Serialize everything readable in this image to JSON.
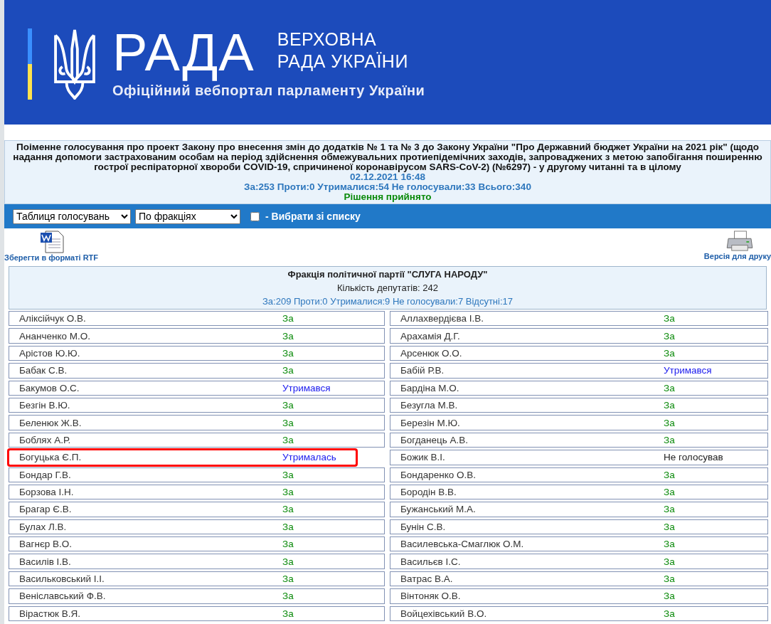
{
  "header": {
    "logo_word": "РАДА",
    "logo_line_1": "ВЕРХОВНА",
    "logo_line_2": "РАДА УКРАЇНИ",
    "tagline": "Офіційний вебпортал парламенту України"
  },
  "vote": {
    "title": "Поіменне голосування про проект Закону про внесення змін до додатків № 1 та № 3 до Закону України \"Про Державний бюджет України на 2021 рік\" (щодо надання допомоги застрахованим особам на період здійснення обмежувальних протиепідемічних заходів, запроваджених з метою запобігання поширенню гострої респіраторної хвороби COVID-19, спричиненої коронавірусом SARS-CoV-2) (№6297) - у другому читанні та в цілому",
    "datetime": "02.12.2021 16:48",
    "totals": "За:253 Проти:0 Утрималися:54 Не голосували:33 Всього:340",
    "result": "Рішення прийнято"
  },
  "toolbar": {
    "view_select": "Таблиця голосувань",
    "group_select": "По фракціях",
    "pick_from_list": {
      "label": "- Вибрати зі списку",
      "checked": false
    }
  },
  "actions": {
    "save_rtf": "Зберегти в форматі RTF",
    "print_version": "Версія для друку"
  },
  "faction": {
    "name": "Фракція політичної партії \"СЛУГА НАРОДУ\"",
    "deputies_count": "Кількість депутатів: 242",
    "totals": "За:209 Проти:0 Утрималися:9 Не голосували:7 Відсутні:17"
  },
  "deputies": [
    {
      "name": "Аліксійчук О.В.",
      "vote": "За",
      "kind": "for",
      "highlighted": false
    },
    {
      "name": "Аллахвердієва І.В.",
      "vote": "За",
      "kind": "for",
      "highlighted": false
    },
    {
      "name": "Ананченко М.О.",
      "vote": "За",
      "kind": "for",
      "highlighted": false
    },
    {
      "name": "Арахамія Д.Г.",
      "vote": "За",
      "kind": "for",
      "highlighted": false
    },
    {
      "name": "Арістов Ю.Ю.",
      "vote": "За",
      "kind": "for",
      "highlighted": false
    },
    {
      "name": "Арсенюк О.О.",
      "vote": "За",
      "kind": "for",
      "highlighted": false
    },
    {
      "name": "Бабак С.В.",
      "vote": "За",
      "kind": "for",
      "highlighted": false
    },
    {
      "name": "Бабій Р.В.",
      "vote": "Утримався",
      "kind": "abstain",
      "highlighted": false
    },
    {
      "name": "Бакумов О.С.",
      "vote": "Утримався",
      "kind": "abstain",
      "highlighted": false
    },
    {
      "name": "Бардіна М.О.",
      "vote": "За",
      "kind": "for",
      "highlighted": false
    },
    {
      "name": "Безгін В.Ю.",
      "vote": "За",
      "kind": "for",
      "highlighted": false
    },
    {
      "name": "Безугла М.В.",
      "vote": "За",
      "kind": "for",
      "highlighted": false
    },
    {
      "name": "Беленюк Ж.В.",
      "vote": "За",
      "kind": "for",
      "highlighted": false
    },
    {
      "name": "Березін М.Ю.",
      "vote": "За",
      "kind": "for",
      "highlighted": false
    },
    {
      "name": "Боблях А.Р.",
      "vote": "За",
      "kind": "for",
      "highlighted": false
    },
    {
      "name": "Богданець А.В.",
      "vote": "За",
      "kind": "for",
      "highlighted": false
    },
    {
      "name": "Богуцька Є.П.",
      "vote": "Утрималась",
      "kind": "abstain",
      "highlighted": true
    },
    {
      "name": "Божик В.І.",
      "vote": "Не голосував",
      "kind": "not_voted",
      "highlighted": false
    },
    {
      "name": "Бондар Г.В.",
      "vote": "За",
      "kind": "for",
      "highlighted": false
    },
    {
      "name": "Бондаренко О.В.",
      "vote": "За",
      "kind": "for",
      "highlighted": false
    },
    {
      "name": "Борзова І.Н.",
      "vote": "За",
      "kind": "for",
      "highlighted": false
    },
    {
      "name": "Бородін В.В.",
      "vote": "За",
      "kind": "for",
      "highlighted": false
    },
    {
      "name": "Брагар Є.В.",
      "vote": "За",
      "kind": "for",
      "highlighted": false
    },
    {
      "name": "Бужанський М.А.",
      "vote": "За",
      "kind": "for",
      "highlighted": false
    },
    {
      "name": "Булах Л.В.",
      "vote": "За",
      "kind": "for",
      "highlighted": false
    },
    {
      "name": "Бунін С.В.",
      "vote": "За",
      "kind": "for",
      "highlighted": false
    },
    {
      "name": "Вагнєр В.О.",
      "vote": "За",
      "kind": "for",
      "highlighted": false
    },
    {
      "name": "Василевська-Смаглюк О.М.",
      "vote": "За",
      "kind": "for",
      "highlighted": false
    },
    {
      "name": "Василів І.В.",
      "vote": "За",
      "kind": "for",
      "highlighted": false
    },
    {
      "name": "Васильєв І.С.",
      "vote": "За",
      "kind": "for",
      "highlighted": false
    },
    {
      "name": "Васильковський І.І.",
      "vote": "За",
      "kind": "for",
      "highlighted": false
    },
    {
      "name": "Ватрас В.А.",
      "vote": "За",
      "kind": "for",
      "highlighted": false
    },
    {
      "name": "Веніславський Ф.В.",
      "vote": "За",
      "kind": "for",
      "highlighted": false
    },
    {
      "name": "Вінтоняк О.В.",
      "vote": "За",
      "kind": "for",
      "highlighted": false
    },
    {
      "name": "Вірастюк В.Я.",
      "vote": "За",
      "kind": "for",
      "highlighted": false
    },
    {
      "name": "Войцехівський В.О.",
      "vote": "За",
      "kind": "for",
      "highlighted": false
    }
  ]
}
